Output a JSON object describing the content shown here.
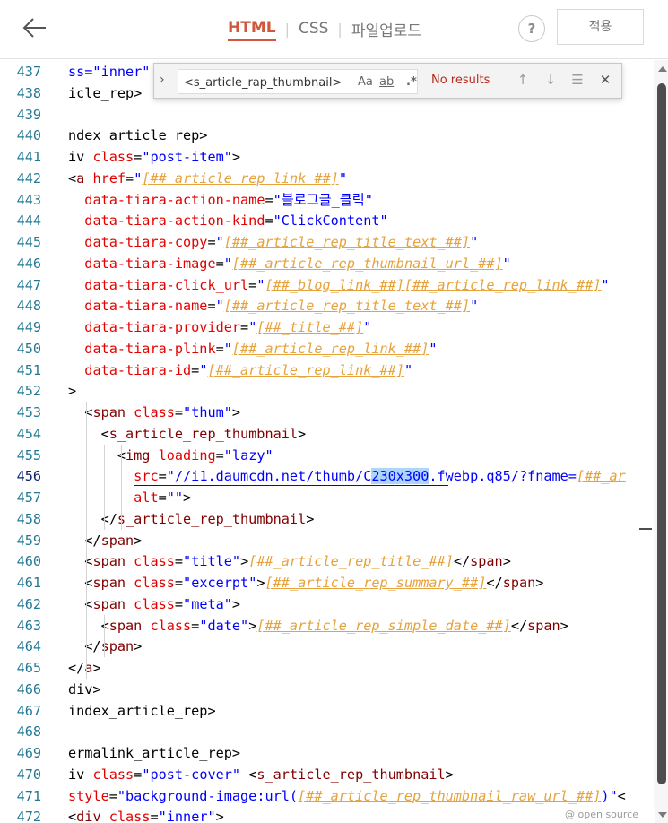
{
  "header": {
    "tabs": [
      {
        "label": "HTML",
        "active": true
      },
      {
        "label": "CSS",
        "active": false
      },
      {
        "label": "파일업로드",
        "active": false
      }
    ],
    "help_label": "?",
    "apply_label": "적용",
    "accent_color": "#d2563b"
  },
  "find_widget": {
    "query": "<s_article_rap_thumbnail>",
    "match_case_label": "Aa",
    "whole_word_label": "ab",
    "regex_label": ".*",
    "result_text": "No results"
  },
  "footer": {
    "label": "@ open source"
  },
  "editor": {
    "current_line": 456,
    "selection_text": "230x300",
    "lines": [
      {
        "n": "437",
        "tokens": [
          [
            "t-str",
            "ss=\"inner\""
          ]
        ]
      },
      {
        "n": "438",
        "tokens": [
          [
            "t-plain",
            "icle_rep>"
          ]
        ]
      },
      {
        "n": "439",
        "tokens": []
      },
      {
        "n": "440",
        "tokens": [
          [
            "t-plain",
            "ndex_article_rep>"
          ]
        ]
      },
      {
        "n": "441",
        "tokens": [
          [
            "t-plain",
            "iv "
          ],
          [
            "t-attr",
            "class"
          ],
          [
            "t-plain",
            "="
          ],
          [
            "t-str",
            "\"post-item\""
          ],
          [
            "t-plain",
            ">"
          ]
        ]
      },
      {
        "n": "442",
        "tokens": [
          [
            "t-plain",
            "<"
          ],
          [
            "t-tag",
            "a"
          ],
          [
            "t-plain",
            " "
          ],
          [
            "t-attr",
            "href"
          ],
          [
            "t-plain",
            "="
          ],
          [
            "t-str",
            "\""
          ],
          [
            "t-tpl",
            "[##_article_rep_link_##]"
          ],
          [
            "t-str",
            "\""
          ]
        ]
      },
      {
        "n": "443",
        "tokens": [
          [
            "t-plain",
            "  "
          ],
          [
            "t-attr",
            "data-tiara-action-name"
          ],
          [
            "t-plain",
            "="
          ],
          [
            "t-str",
            "\"블로그글_클릭\""
          ]
        ]
      },
      {
        "n": "444",
        "tokens": [
          [
            "t-plain",
            "  "
          ],
          [
            "t-attr",
            "data-tiara-action-kind"
          ],
          [
            "t-plain",
            "="
          ],
          [
            "t-str",
            "\"ClickContent\""
          ]
        ]
      },
      {
        "n": "445",
        "tokens": [
          [
            "t-plain",
            "  "
          ],
          [
            "t-attr",
            "data-tiara-copy"
          ],
          [
            "t-plain",
            "="
          ],
          [
            "t-str",
            "\""
          ],
          [
            "t-tpl",
            "[##_article_rep_title_text_##]"
          ],
          [
            "t-str",
            "\""
          ]
        ]
      },
      {
        "n": "446",
        "tokens": [
          [
            "t-plain",
            "  "
          ],
          [
            "t-attr",
            "data-tiara-image"
          ],
          [
            "t-plain",
            "="
          ],
          [
            "t-str",
            "\""
          ],
          [
            "t-tpl",
            "[##_article_rep_thumbnail_url_##]"
          ],
          [
            "t-str",
            "\""
          ]
        ]
      },
      {
        "n": "447",
        "tokens": [
          [
            "t-plain",
            "  "
          ],
          [
            "t-attr",
            "data-tiara-click_url"
          ],
          [
            "t-plain",
            "="
          ],
          [
            "t-str",
            "\""
          ],
          [
            "t-tpl",
            "[##_blog_link_##][##_article_rep_link_##]"
          ],
          [
            "t-str",
            "\""
          ]
        ]
      },
      {
        "n": "448",
        "tokens": [
          [
            "t-plain",
            "  "
          ],
          [
            "t-attr",
            "data-tiara-name"
          ],
          [
            "t-plain",
            "="
          ],
          [
            "t-str",
            "\""
          ],
          [
            "t-tpl",
            "[##_article_rep_title_text_##]"
          ],
          [
            "t-str",
            "\""
          ]
        ]
      },
      {
        "n": "449",
        "tokens": [
          [
            "t-plain",
            "  "
          ],
          [
            "t-attr",
            "data-tiara-provider"
          ],
          [
            "t-plain",
            "="
          ],
          [
            "t-str",
            "\""
          ],
          [
            "t-tpl",
            "[##_title_##]"
          ],
          [
            "t-str",
            "\""
          ]
        ]
      },
      {
        "n": "450",
        "tokens": [
          [
            "t-plain",
            "  "
          ],
          [
            "t-attr",
            "data-tiara-plink"
          ],
          [
            "t-plain",
            "="
          ],
          [
            "t-str",
            "\""
          ],
          [
            "t-tpl",
            "[##_article_rep_link_##]"
          ],
          [
            "t-str",
            "\""
          ]
        ]
      },
      {
        "n": "451",
        "tokens": [
          [
            "t-plain",
            "  "
          ],
          [
            "t-attr",
            "data-tiara-id"
          ],
          [
            "t-plain",
            "="
          ],
          [
            "t-str",
            "\""
          ],
          [
            "t-tpl",
            "[##_article_rep_link_##]"
          ],
          [
            "t-str",
            "\""
          ]
        ]
      },
      {
        "n": "452",
        "tokens": [
          [
            "t-plain",
            ">"
          ]
        ]
      },
      {
        "n": "453",
        "tokens": [
          [
            "t-plain",
            "  <"
          ],
          [
            "t-tag",
            "span"
          ],
          [
            "t-plain",
            " "
          ],
          [
            "t-attr",
            "class"
          ],
          [
            "t-plain",
            "="
          ],
          [
            "t-str",
            "\"thum\""
          ],
          [
            "t-plain",
            ">"
          ]
        ]
      },
      {
        "n": "454",
        "tokens": [
          [
            "t-plain",
            "    <"
          ],
          [
            "t-tag",
            "s_article_rep_thumbnail"
          ],
          [
            "t-plain",
            ">"
          ]
        ]
      },
      {
        "n": "455",
        "tokens": [
          [
            "t-plain",
            "      <"
          ],
          [
            "t-tag",
            "img"
          ],
          [
            "t-plain",
            " "
          ],
          [
            "t-attr",
            "loading"
          ],
          [
            "t-plain",
            "="
          ],
          [
            "t-str",
            "\"lazy\""
          ]
        ]
      },
      {
        "n": "456",
        "tokens": [
          [
            "t-plain",
            "        "
          ],
          [
            "t-attr",
            "src"
          ],
          [
            "t-plain",
            "="
          ],
          [
            "t-str",
            "\"//i1.daumcdn.net/thumb/C"
          ],
          [
            "sel",
            "230x300"
          ],
          [
            "t-str",
            ".fwebp.q85/?fname="
          ],
          [
            "t-tpl",
            "[##_ar"
          ]
        ]
      },
      {
        "n": "457",
        "tokens": [
          [
            "t-plain",
            "        "
          ],
          [
            "t-attr",
            "alt"
          ],
          [
            "t-plain",
            "="
          ],
          [
            "t-str",
            "\"\""
          ],
          [
            "t-plain",
            ">"
          ]
        ]
      },
      {
        "n": "458",
        "tokens": [
          [
            "t-plain",
            "    </"
          ],
          [
            "t-tag",
            "s_article_rep_thumbnail"
          ],
          [
            "t-plain",
            ">"
          ]
        ]
      },
      {
        "n": "459",
        "tokens": [
          [
            "t-plain",
            "  </"
          ],
          [
            "t-tag",
            "span"
          ],
          [
            "t-plain",
            ">"
          ]
        ]
      },
      {
        "n": "460",
        "tokens": [
          [
            "t-plain",
            "  <"
          ],
          [
            "t-tag",
            "span"
          ],
          [
            "t-plain",
            " "
          ],
          [
            "t-attr",
            "class"
          ],
          [
            "t-plain",
            "="
          ],
          [
            "t-str",
            "\"title\""
          ],
          [
            "t-plain",
            ">"
          ],
          [
            "t-tpl",
            "[##_article_rep_title_##]"
          ],
          [
            "t-plain",
            "</"
          ],
          [
            "t-tag",
            "span"
          ],
          [
            "t-plain",
            ">"
          ]
        ]
      },
      {
        "n": "461",
        "tokens": [
          [
            "t-plain",
            "  <"
          ],
          [
            "t-tag",
            "span"
          ],
          [
            "t-plain",
            " "
          ],
          [
            "t-attr",
            "class"
          ],
          [
            "t-plain",
            "="
          ],
          [
            "t-str",
            "\"excerpt\""
          ],
          [
            "t-plain",
            ">"
          ],
          [
            "t-tpl",
            "[##_article_rep_summary_##]"
          ],
          [
            "t-plain",
            "</"
          ],
          [
            "t-tag",
            "span"
          ],
          [
            "t-plain",
            ">"
          ]
        ]
      },
      {
        "n": "462",
        "tokens": [
          [
            "t-plain",
            "  <"
          ],
          [
            "t-tag",
            "span"
          ],
          [
            "t-plain",
            " "
          ],
          [
            "t-attr",
            "class"
          ],
          [
            "t-plain",
            "="
          ],
          [
            "t-str",
            "\"meta\""
          ],
          [
            "t-plain",
            ">"
          ]
        ]
      },
      {
        "n": "463",
        "tokens": [
          [
            "t-plain",
            "    <"
          ],
          [
            "t-tag",
            "span"
          ],
          [
            "t-plain",
            " "
          ],
          [
            "t-attr",
            "class"
          ],
          [
            "t-plain",
            "="
          ],
          [
            "t-str",
            "\"date\""
          ],
          [
            "t-plain",
            ">"
          ],
          [
            "t-tpl",
            "[##_article_rep_simple_date_##]"
          ],
          [
            "t-plain",
            "</"
          ],
          [
            "t-tag",
            "span"
          ],
          [
            "t-plain",
            ">"
          ]
        ]
      },
      {
        "n": "464",
        "tokens": [
          [
            "t-plain",
            "  </"
          ],
          [
            "t-tag",
            "span"
          ],
          [
            "t-plain",
            ">"
          ]
        ]
      },
      {
        "n": "465",
        "tokens": [
          [
            "t-plain",
            "</"
          ],
          [
            "t-tag",
            "a"
          ],
          [
            "t-plain",
            ">"
          ]
        ]
      },
      {
        "n": "466",
        "tokens": [
          [
            "t-plain",
            "div>"
          ]
        ]
      },
      {
        "n": "467",
        "tokens": [
          [
            "t-plain",
            "index_article_rep>"
          ]
        ]
      },
      {
        "n": "468",
        "tokens": []
      },
      {
        "n": "469",
        "tokens": [
          [
            "t-plain",
            "ermalink_article_rep>"
          ]
        ]
      },
      {
        "n": "470",
        "tokens": [
          [
            "t-plain",
            "iv "
          ],
          [
            "t-attr",
            "class"
          ],
          [
            "t-plain",
            "="
          ],
          [
            "t-str",
            "\"post-cover\""
          ],
          [
            "t-plain",
            " <"
          ],
          [
            "t-tag",
            "s_article_rep_thumbnail"
          ],
          [
            "t-plain",
            ">"
          ]
        ]
      },
      {
        "n": "471",
        "tokens": [
          [
            "t-attr",
            "style"
          ],
          [
            "t-plain",
            "="
          ],
          [
            "t-str",
            "\"background-image:url("
          ],
          [
            "t-tpl",
            "[##_article_rep_thumbnail_raw_url_##]"
          ],
          [
            "t-str",
            ")\""
          ],
          [
            "t-plain",
            "<"
          ]
        ]
      },
      {
        "n": "472",
        "tokens": [
          [
            "t-plain",
            "<"
          ],
          [
            "t-tag",
            "div"
          ],
          [
            "t-plain",
            " "
          ],
          [
            "t-attr",
            "class"
          ],
          [
            "t-plain",
            "="
          ],
          [
            "t-str",
            "\"inner\""
          ],
          [
            "t-plain",
            ">"
          ]
        ]
      }
    ]
  }
}
